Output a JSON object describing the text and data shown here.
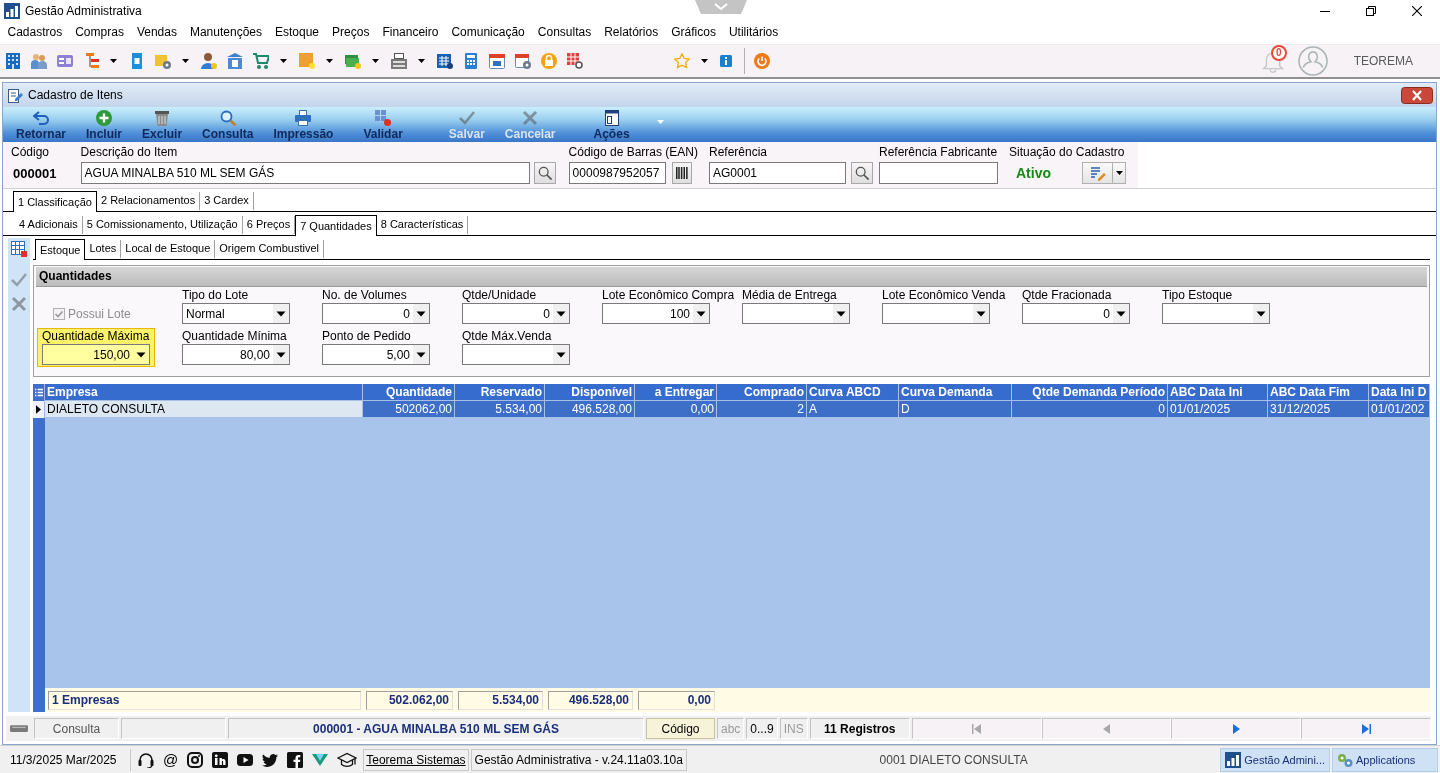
{
  "window": {
    "title": "Gestão Administrativa"
  },
  "menu": [
    "Cadastros",
    "Compras",
    "Vendas",
    "Manutenções",
    "Estoque",
    "Preços",
    "Financeiro",
    "Comunicação",
    "Consultas",
    "Relatórios",
    "Gráficos",
    "Utilitários"
  ],
  "notifications": {
    "badge": "0"
  },
  "user": {
    "name": "TEOREMA"
  },
  "form": {
    "title": "Cadastro de Itens",
    "actions": [
      {
        "label": "Retornar",
        "disabled": false
      },
      {
        "label": "Incluir",
        "disabled": false
      },
      {
        "label": "Excluir",
        "disabled": false
      },
      {
        "label": "Consulta",
        "disabled": false
      },
      {
        "label": "Impressão",
        "disabled": false
      },
      {
        "label": "Validar",
        "disabled": false
      },
      {
        "label": "Salvar",
        "disabled": true
      },
      {
        "label": "Cancelar",
        "disabled": true
      },
      {
        "label": "Ações",
        "disabled": false
      }
    ],
    "header": {
      "code": {
        "label": "Código",
        "value": "000001"
      },
      "description": {
        "label": "Descrição do Item",
        "value": "AGUA MINALBA 510 ML SEM GÁS"
      },
      "barcode": {
        "label": "Código de Barras (EAN)",
        "value": "0000987952057"
      },
      "reference": {
        "label": "Referência",
        "value": "AG0001"
      },
      "manufacturer_reference": {
        "label": "Referência Fabricante"
      },
      "status": {
        "label": "Situação do Cadastro",
        "value": "Ativo"
      }
    },
    "tab_rows": [
      [
        {
          "label": "1 Classificação",
          "selected": true
        },
        {
          "label": "2 Relacionamentos",
          "selected": false
        },
        {
          "label": "3 Cardex",
          "selected": false
        }
      ],
      [
        {
          "label": "4 Adicionais",
          "selected": false
        },
        {
          "label": "5 Comissionamento, Utilização",
          "selected": false
        },
        {
          "label": "6 Preços",
          "selected": false
        },
        {
          "label": "7 Quantidades",
          "selected": true
        },
        {
          "label": "8 Características",
          "selected": false
        }
      ]
    ],
    "side_tools": [
      {
        "disabled": false
      },
      {
        "disabled": true
      },
      {
        "disabled": true
      }
    ],
    "sub_tabs": [
      {
        "label": "Estoque",
        "selected": true
      },
      {
        "label": "Lotes",
        "selected": false
      },
      {
        "label": "Local de Estoque",
        "selected": false
      },
      {
        "label": "Origem Combustivel",
        "selected": false
      }
    ],
    "quantities": {
      "title": "Quantidades",
      "rows": [
        [
          {
            "kind": "checkbox",
            "label": "Possui Lote",
            "checked": true,
            "disabled": true
          },
          {
            "kind": "select",
            "label": "Tipo do Lote",
            "value": "Normal",
            "focused": false
          },
          {
            "kind": "number",
            "label": "No. de Volumes",
            "value": "0",
            "focused": false
          },
          {
            "kind": "number",
            "label": "Qtde/Unidade",
            "value": "0",
            "focused": false
          },
          {
            "kind": "number",
            "label": "Lote Econômico Compra",
            "value": "100",
            "focused": false
          },
          {
            "kind": "number",
            "label": "Média de Entrega",
            "focused": false
          },
          {
            "kind": "number",
            "label": "Lote Econômico Venda",
            "focused": false
          },
          {
            "kind": "number",
            "label": "Qtde Fracionada",
            "value": "0",
            "focused": false
          },
          {
            "kind": "select",
            "label": "Tipo Estoque",
            "focused": false
          }
        ],
        [
          {
            "kind": "number",
            "label": "Quantidade Máxima",
            "value": "150,00",
            "focused": true
          },
          {
            "kind": "number",
            "label": "Quantidade Mínima",
            "value": "80,00",
            "focused": false
          },
          {
            "kind": "number",
            "label": "Ponto de Pedido",
            "value": "5,00",
            "focused": false
          },
          {
            "kind": "number",
            "label": "Qtde Máx.Venda",
            "focused": false
          }
        ]
      ]
    },
    "grid": {
      "columns": [
        {
          "label": "Empresa",
          "kind": "text"
        },
        {
          "label": "Quantidade",
          "kind": "number"
        },
        {
          "label": "Reservado",
          "kind": "number"
        },
        {
          "label": "Disponível",
          "kind": "number"
        },
        {
          "label": "a Entregar",
          "kind": "number"
        },
        {
          "label": "Comprado",
          "kind": "number"
        },
        {
          "label": "Curva ABCD",
          "kind": "text"
        },
        {
          "label": "Curva Demanda",
          "kind": "text"
        },
        {
          "label": "Qtde Demanda Período",
          "kind": "number"
        },
        {
          "label": "ABC Data Ini",
          "kind": "text"
        },
        {
          "label": "ABC Data Fim",
          "kind": "text"
        },
        {
          "label": "Data Ini D",
          "kind": "text"
        }
      ],
      "rows": [
        {
          "selected": true,
          "cells": [
            "DIALETO CONSULTA",
            "502062,00",
            "5.534,00",
            "496.528,00",
            "0,00",
            "2",
            "A",
            "D",
            "0",
            "01/01/2025",
            "31/12/2025",
            "01/01/202"
          ]
        }
      ],
      "totals": [
        "1 Empresas",
        "502.062,00",
        "5.534,00",
        "496.528,00",
        "0,00"
      ]
    }
  },
  "status_bar": {
    "mode": "Consulta",
    "record": "000001 - AGUA MINALBA 510 ML SEM GÁS",
    "search_key": "Código",
    "indicators": [
      {
        "label": "abc",
        "on": false
      },
      {
        "label": "0...9",
        "on": true
      },
      {
        "label": "INS",
        "on": false
      }
    ],
    "count": "11 Registros",
    "navigation": [
      {
        "disabled": true
      },
      {
        "disabled": true
      },
      {
        "disabled": false
      },
      {
        "disabled": false
      }
    ]
  },
  "taskbar": {
    "date": "11/3/2025 Mar/2025",
    "at_sign": "@",
    "link": "Teorema Sistemas",
    "version": "Gestão Administrativa - v.24.11a03.10a",
    "company": "0001 DIALETO CONSULTA",
    "windows": [
      {
        "label": "Gestão Admini..."
      },
      {
        "label": "Applications"
      }
    ]
  }
}
